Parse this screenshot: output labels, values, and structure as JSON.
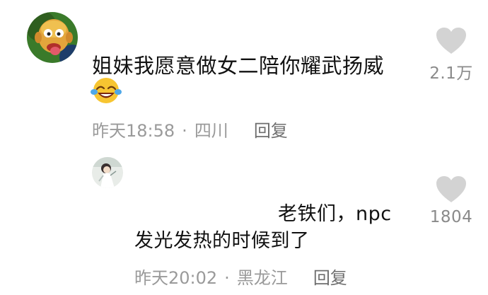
{
  "comments": [
    {
      "text": "姐妹我愿意做女二陪你耀武扬威",
      "emoji": "laughing-tears-emoji",
      "time": "昨天18:58",
      "separator": "·",
      "location": "四川",
      "reply_label": "回复",
      "like_count": "2.1万"
    },
    {
      "text_line1": "老铁们，npc",
      "text_line2": "发光发热的时候到了",
      "time": "昨天20:02",
      "separator": "·",
      "location": "黑龙江",
      "reply_label": "回复",
      "like_count": "1804"
    }
  ],
  "icons": {
    "like": "heart-icon",
    "avatar1": "cartoon-avatar",
    "avatar2": "user-avatar"
  },
  "colors": {
    "text": "#111111",
    "meta": "#9a9a9a",
    "heart": "#d3d3d3"
  }
}
